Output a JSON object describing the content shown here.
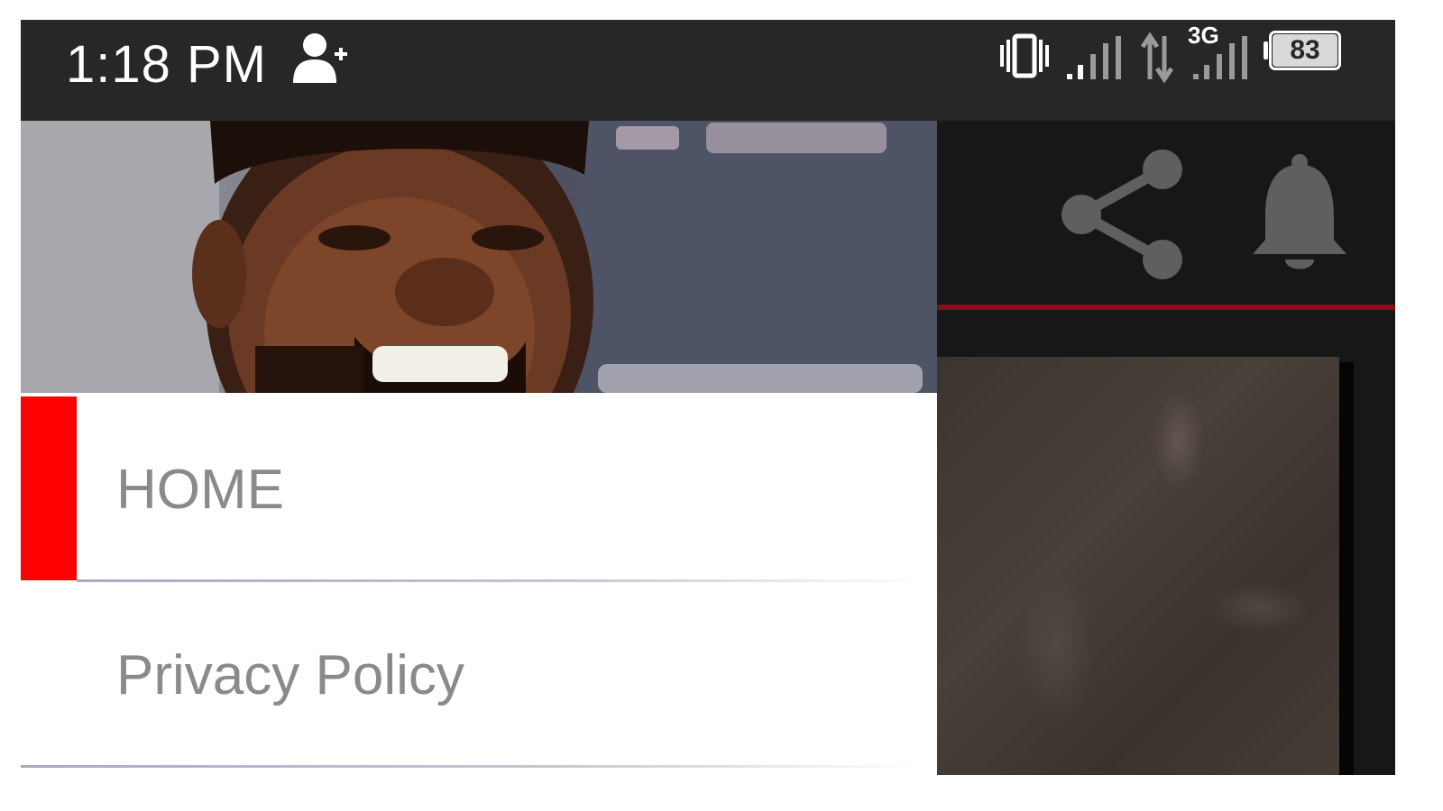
{
  "status_bar": {
    "time": "1:18 PM",
    "network_type": "3G",
    "battery_level": "83",
    "icons": [
      "add-person-icon",
      "vibrate-icon",
      "signal-icon",
      "data-transfer-icon",
      "signal-icon",
      "battery-icon"
    ]
  },
  "app_toolbar": {
    "icons": [
      "share-icon",
      "bell-icon"
    ],
    "accent_color": "#8d0d0f"
  },
  "drawer": {
    "menu": [
      {
        "label": "HOME",
        "active": true
      },
      {
        "label": "Privacy Policy",
        "active": false
      }
    ],
    "active_color": "#ff0000"
  }
}
